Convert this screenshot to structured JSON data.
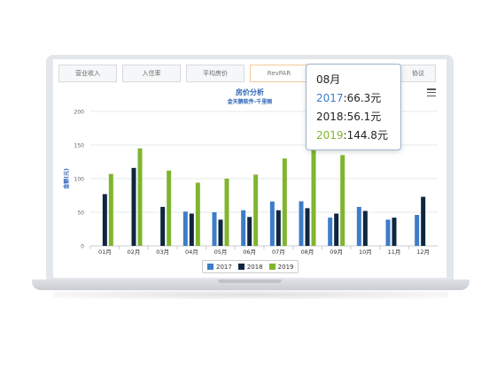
{
  "tabs": [
    {
      "label": "营业收入",
      "active": false
    },
    {
      "label": "入住率",
      "active": false
    },
    {
      "label": "平均房价",
      "active": false
    },
    {
      "label": "RevPAR",
      "active": true
    },
    {
      "label": "协议",
      "active": false
    }
  ],
  "chart_data": {
    "type": "bar",
    "title": "房价分析",
    "subtitle": "金天鹅软件-千里眼",
    "ylabel": "金额(元)",
    "xlabel": "",
    "ylim": [
      0,
      200
    ],
    "yticks": [
      0,
      50,
      100,
      150,
      200
    ],
    "grid": true,
    "legend_position": "bottom",
    "categories": [
      "01月",
      "02月",
      "03月",
      "04月",
      "05月",
      "06月",
      "07月",
      "08月",
      "09月",
      "10月",
      "11月",
      "12月"
    ],
    "series": [
      {
        "name": "2017",
        "color": "#3d7cc9",
        "values": [
          null,
          null,
          null,
          51,
          50,
          53,
          66,
          66.3,
          42,
          58,
          39,
          46
        ]
      },
      {
        "name": "2018",
        "color": "#0f2640",
        "values": [
          77,
          116,
          58,
          48,
          39,
          43,
          53,
          56.1,
          48,
          52,
          42,
          73
        ]
      },
      {
        "name": "2019",
        "color": "#7fb52f",
        "values": [
          107,
          145,
          112,
          94,
          100,
          106,
          130,
          144.8,
          135,
          null,
          null,
          null
        ]
      }
    ]
  },
  "tooltip": {
    "month": "08月",
    "rows": [
      {
        "series": "2017",
        "value": ":66.3元",
        "color": "#3d7cc9"
      },
      {
        "series": "2018",
        "value": ":56.1元",
        "color": "#222222"
      },
      {
        "series": "2019",
        "value": ":144.8元",
        "color": "#7fb52f"
      }
    ]
  }
}
